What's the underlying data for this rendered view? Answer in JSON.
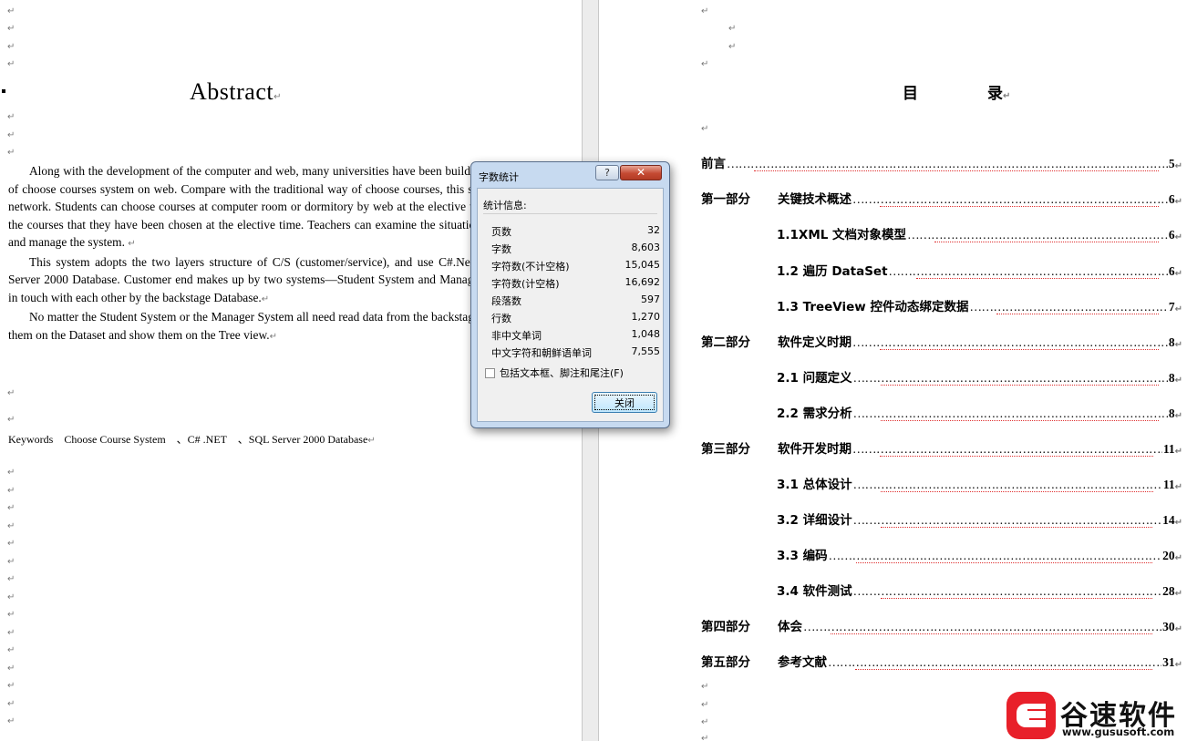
{
  "left_page": {
    "title": "Abstract",
    "paragraphs": [
      "Along with the development of the computer and web, many universities have been build C/S or B/S structure of choose courses system on web. Compare with the traditional way of choose courses, this system use local area network. Students can choose courses at computer room or dormitory by web at the elective time also can change the courses that they have been chosen at the elective time. Teachers can examine the situation of choose courses and manage the system.",
      "This system adopts the two layers structure of C/S (customer/service), and use C#.Net language and SQL Server 2000 Database. Customer end makes up by two systems—Student System and Manager System. They get in touch with each other by the backstage Database.",
      "No matter the Student System or the Manager System all need read data from the backstage Database, then put them on the Dataset and show them on the Tree view."
    ],
    "keywords": "Keywords　Choose Course System　、C# .NET　、SQL Server 2000 Database"
  },
  "right_page": {
    "title_chars": [
      "目",
      "录"
    ],
    "toc": [
      {
        "part": "",
        "label": "前言",
        "page": "5",
        "indent": 0
      },
      {
        "part": "第一部分",
        "label": "关键技术概述",
        "page": "6",
        "indent": 0
      },
      {
        "part": "",
        "label": "1.1XML 文档对象模型",
        "page": "6",
        "indent": 1
      },
      {
        "part": "",
        "label": "1.2  遍历 DataSet",
        "page": "6",
        "indent": 1
      },
      {
        "part": "",
        "label": "1.3 TreeView 控件动态绑定数据",
        "page": "7",
        "indent": 1
      },
      {
        "part": "第二部分",
        "label": "软件定义时期",
        "page": "8",
        "indent": 0
      },
      {
        "part": "",
        "label": "2.1 问题定义",
        "page": "8",
        "indent": 1
      },
      {
        "part": "",
        "label": "2.2  需求分析",
        "page": "8",
        "indent": 1
      },
      {
        "part": "第三部分",
        "label": "软件开发时期",
        "page": "11",
        "indent": 0
      },
      {
        "part": "",
        "label": "3.1 总体设计",
        "page": "11",
        "indent": 1
      },
      {
        "part": "",
        "label": "3.2  详细设计",
        "page": "14",
        "indent": 1
      },
      {
        "part": "",
        "label": "3.3 编码",
        "page": "20",
        "indent": 1
      },
      {
        "part": "",
        "label": "3.4  软件测试",
        "page": "28",
        "indent": 1
      },
      {
        "part": "第四部分",
        "label": "体会",
        "page": "30",
        "indent": 0
      },
      {
        "part": "第五部分",
        "label": "参考文献",
        "page": "31",
        "indent": 0
      }
    ]
  },
  "dialog": {
    "title": "字数统计",
    "help_label": "?",
    "close_icon_label": "✕",
    "group_label": "统计信息:",
    "stats": [
      {
        "label": "页数",
        "value": "32"
      },
      {
        "label": "字数",
        "value": "8,603"
      },
      {
        "label": "字符数(不计空格)",
        "value": "15,045"
      },
      {
        "label": "字符数(计空格)",
        "value": "16,692"
      },
      {
        "label": "段落数",
        "value": "597"
      },
      {
        "label": "行数",
        "value": "1,270"
      },
      {
        "label": "非中文单词",
        "value": "1,048"
      },
      {
        "label": "中文字符和朝鲜语单词",
        "value": "7,555"
      }
    ],
    "checkbox_label": "包括文本框、脚注和尾注(F)",
    "checkbox_checked": false,
    "close_button_label": "关闭"
  },
  "watermark": {
    "brand": "谷速软件",
    "url": "www.gususoft.com",
    "color": "#e8202a"
  }
}
